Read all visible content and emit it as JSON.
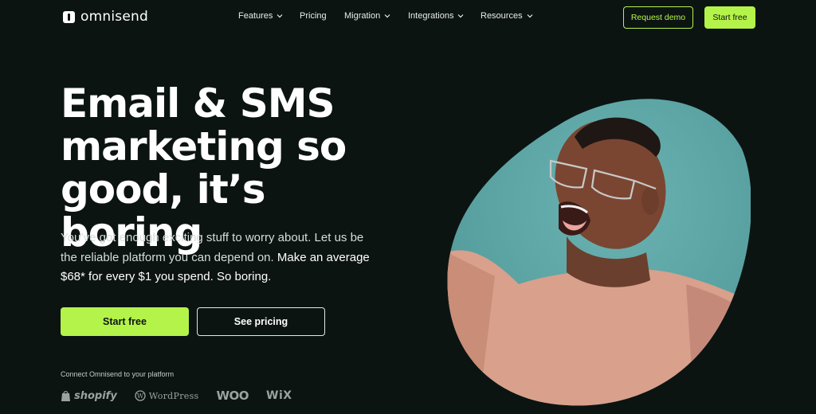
{
  "nav": {
    "logo_text": "omnisend",
    "menu": [
      {
        "label": "Features",
        "dropdown": true
      },
      {
        "label": "Pricing",
        "dropdown": false
      },
      {
        "label": "Migration",
        "dropdown": true
      },
      {
        "label": "Integrations",
        "dropdown": true
      },
      {
        "label": "Resources",
        "dropdown": true
      }
    ],
    "request_demo": "Request demo",
    "start_free": "Start free"
  },
  "hero": {
    "headline_line1": "Email & SMS",
    "headline_line2": "marketing so",
    "headline_line3": "good, it’s boring",
    "sub_part1": "You’ve got enough exciting stuff to worry about. Let us be the reliable platform you can depend on.",
    "sub_part2": "Make an average $68* for every $1 you spend. So boring.",
    "start_free": "Start free",
    "see_pricing": "See pricing"
  },
  "platforms": {
    "caption": "Connect Omnisend to your platform",
    "logos": [
      "shopify",
      "WordPress",
      "WOO",
      "WiX"
    ]
  },
  "colors": {
    "background": "#0c1412",
    "accent": "#b4f34a",
    "photo_bg": "#5fa8a8"
  }
}
